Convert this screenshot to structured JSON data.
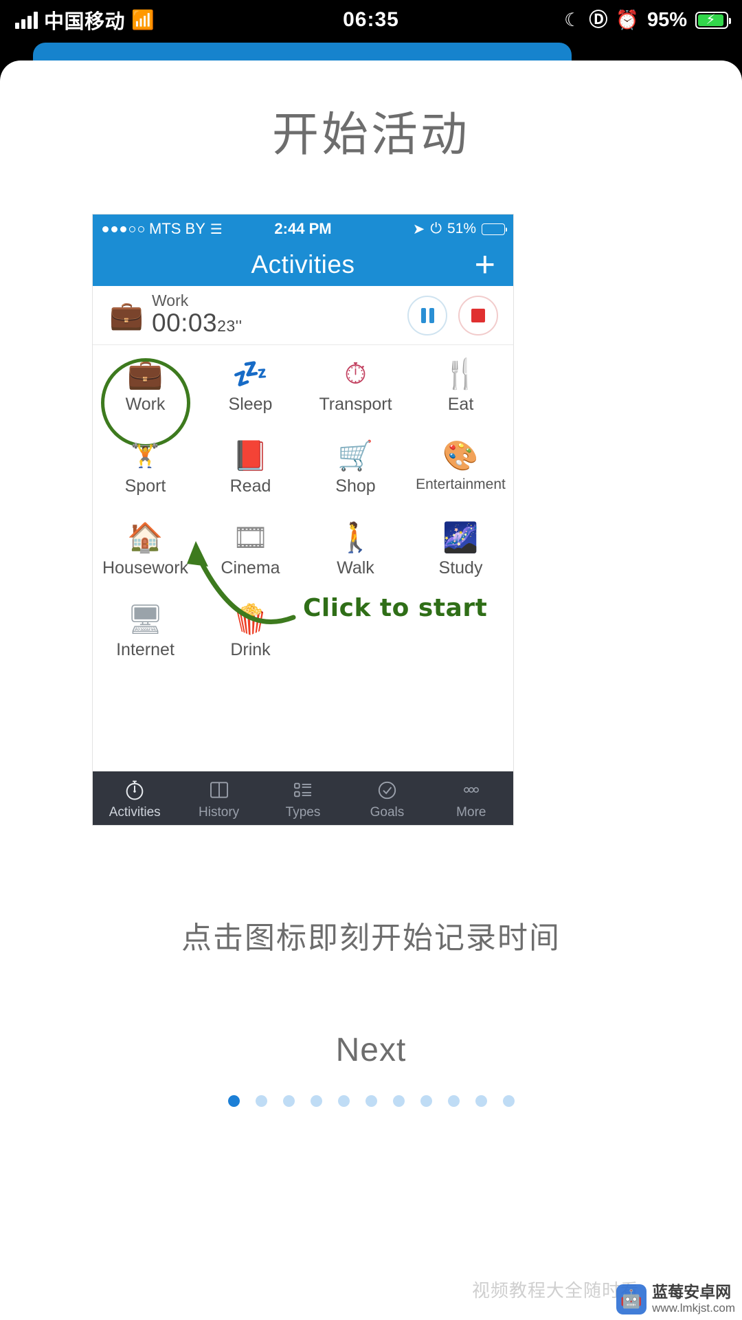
{
  "phone_status": {
    "carrier": "中国移动",
    "time": "06:35",
    "battery_percent": "95%",
    "icons": [
      "signal-bars-icon",
      "wifi-icon",
      "moon-icon",
      "rotation-lock-icon",
      "alarm-icon",
      "battery-charging-icon"
    ]
  },
  "onboarding": {
    "title": "开始活动",
    "caption": "点击图标即刻开始记录时间",
    "next_label": "Next",
    "page_count": 11,
    "active_page": 1
  },
  "screenshot": {
    "status_bar": {
      "carrier": "MTS BY",
      "signal_dots_filled": 3,
      "signal_dots_total": 5,
      "time": "2:44 PM",
      "battery_percent": "51%",
      "icons": [
        "location-arrow-icon",
        "bluetooth-icon",
        "battery-icon",
        "wifi-icon"
      ]
    },
    "nav": {
      "title": "Activities",
      "add_label": "+"
    },
    "running_timer": {
      "icon": "briefcase-icon",
      "activity": "Work",
      "time": "00:03",
      "seconds_sup": "23''",
      "pause_label": "pause-button",
      "stop_label": "stop-button"
    },
    "activities": [
      {
        "label": "Work",
        "icon": "briefcase-icon",
        "glyph": "💼",
        "highlighted": true
      },
      {
        "label": "Sleep",
        "icon": "sleep-icon",
        "glyph": "💤",
        "highlighted": false
      },
      {
        "label": "Transport",
        "icon": "speedometer-icon",
        "glyph": "🕐",
        "highlighted": false
      },
      {
        "label": "Eat",
        "icon": "cutlery-icon",
        "glyph": "🍴",
        "highlighted": false
      },
      {
        "label": "Sport",
        "icon": "dumbbell-icon",
        "glyph": "🏋",
        "highlighted": false
      },
      {
        "label": "Read",
        "icon": "book-icon",
        "glyph": "📕",
        "highlighted": false
      },
      {
        "label": "Shop",
        "icon": "shopping-cart-icon",
        "glyph": "🛒",
        "highlighted": false
      },
      {
        "label": "Entertainment",
        "icon": "palette-icon",
        "glyph": "🎨",
        "highlighted": false
      },
      {
        "label": "Housework",
        "icon": "house-icon",
        "glyph": "🏠",
        "highlighted": false
      },
      {
        "label": "Cinema",
        "icon": "film-icon",
        "glyph": "🎞",
        "highlighted": false
      },
      {
        "label": "Walk",
        "icon": "walking-icon",
        "glyph": "🚶",
        "highlighted": false
      },
      {
        "label": "Study",
        "icon": "planet-icon",
        "glyph": "🪐",
        "highlighted": false
      },
      {
        "label": "Internet",
        "icon": "monitor-icon",
        "glyph": "🖥",
        "highlighted": false
      },
      {
        "label": "Drink",
        "icon": "drink-icon",
        "glyph": "🥤",
        "highlighted": false
      }
    ],
    "annotation": {
      "text": "Click to start",
      "circle_target": "Work",
      "color": "#3d7a1e"
    },
    "tabs": [
      {
        "label": "Activities",
        "icon": "stopwatch-icon",
        "active": true
      },
      {
        "label": "History",
        "icon": "book-open-icon",
        "active": false
      },
      {
        "label": "Types",
        "icon": "list-icon",
        "active": false
      },
      {
        "label": "Goals",
        "icon": "check-circle-icon",
        "active": false
      },
      {
        "label": "More",
        "icon": "ellipsis-icon",
        "active": false
      }
    ]
  },
  "watermark": {
    "name": "蓝莓安卓网",
    "url": "www.lmkjst.com",
    "faint_text": "视频教程大全随时看"
  },
  "colors": {
    "app_blue": "#1b8dd4",
    "annotation_green": "#3d7a1e",
    "tabbar_dark": "#32363f",
    "title_gray": "#6d6d6d",
    "accent_dot": "#1c7fd6"
  }
}
